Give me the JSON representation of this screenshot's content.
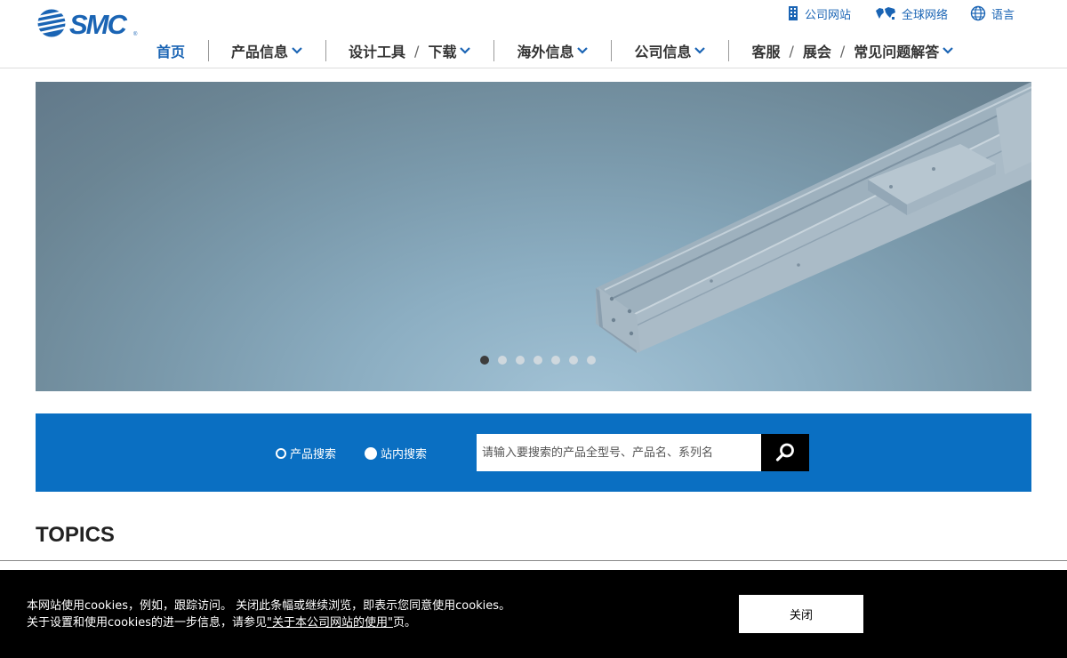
{
  "header": {
    "logo_text": "SMC",
    "utility": {
      "company_site": "公司网站",
      "global_network": "全球网络",
      "language": "语言"
    },
    "nav": {
      "home": "首页",
      "products": "产品信息",
      "design_tools": "设计工具",
      "download": "下载",
      "overseas": "海外信息",
      "company": "公司信息",
      "service": "客服",
      "exhibition": "展会",
      "faq": "常见问题解答",
      "slash": "/"
    }
  },
  "hero": {
    "slide_count": 7,
    "active_slide": 1
  },
  "search": {
    "option_product": "产品搜索",
    "option_site": "站内搜索",
    "placeholder": "请输入要搜索的产品全型号、产品名、系列名",
    "value": ""
  },
  "topics": {
    "heading": "TOPICS"
  },
  "cookie": {
    "line1": "本网站使用cookies，例如，跟踪访问。 关闭此条幅或继续浏览，即表示您同意使用cookies。",
    "line2_prefix": "关于设置和使用cookies的进一步信息，请参见",
    "line2_link": "\"关于本公司网站的使用\"",
    "line2_suffix": "页。",
    "close_label": "关闭"
  },
  "colors": {
    "brand_blue": "#1a64b4",
    "search_band": "#0a6fc2",
    "cookie_bg": "#000000"
  }
}
